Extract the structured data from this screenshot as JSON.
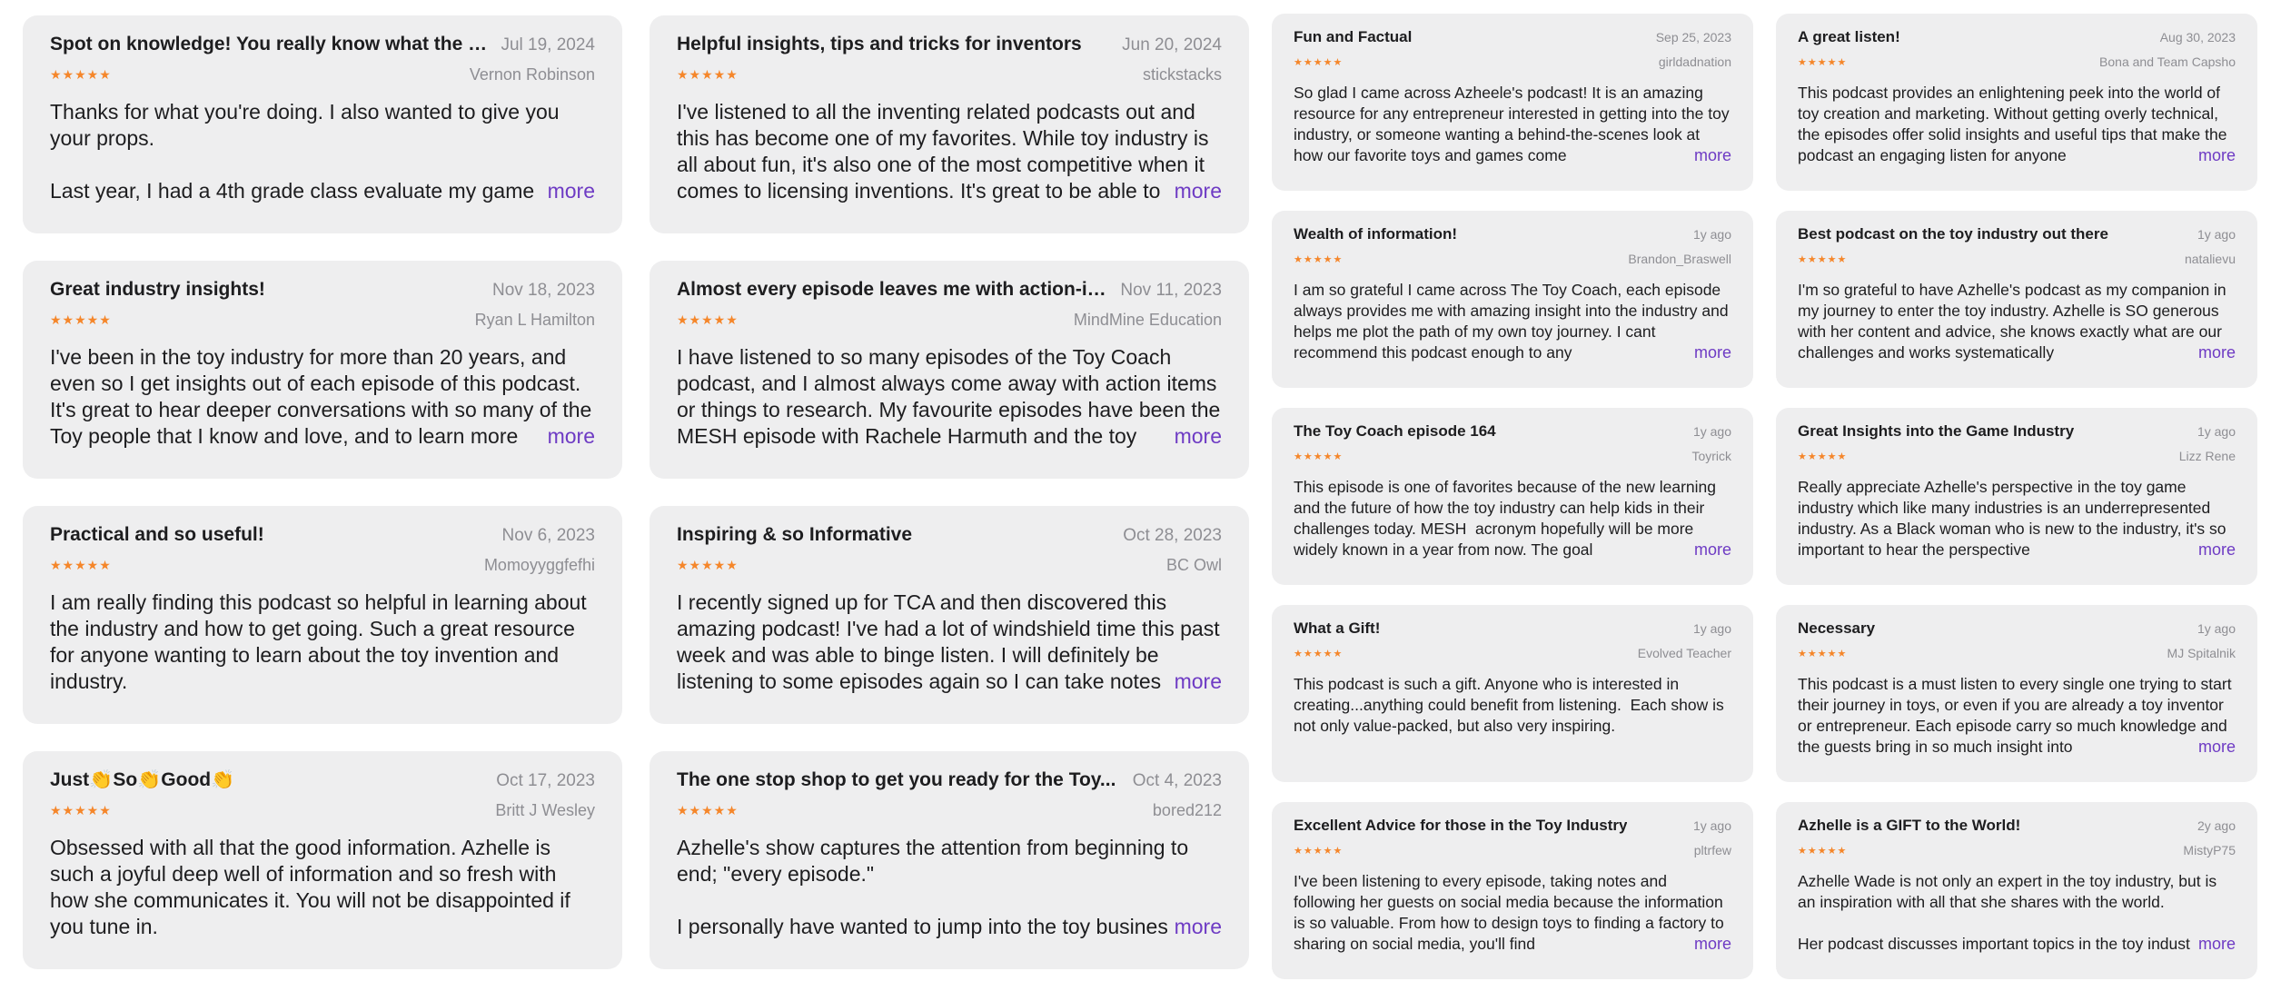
{
  "left_reviews": [
    {
      "title": "Spot on knowledge! You really know what the k...",
      "date": "Jul 19, 2024",
      "author": "Vernon Robinson",
      "stars": "★★★★★",
      "body": "Thanks for what you're doing. I also wanted to give you your props.\n\nLast year, I had a 4th grade class evaluate my game",
      "more": "more"
    },
    {
      "title": "Helpful insights, tips and tricks for inventors",
      "date": "Jun 20, 2024",
      "author": "stickstacks",
      "stars": "★★★★★",
      "body": "I've listened to all the inventing related podcasts out and this has become one of my favorites. While toy industry is all about fun, it's also one of the most competitive when it comes to licensing inventions. It's great to be able to",
      "more": "more"
    },
    {
      "title": "Great industry insights!",
      "date": "Nov 18, 2023",
      "author": "Ryan L Hamilton",
      "stars": "★★★★★",
      "body": "I've been in the toy industry for more than 20 years, and even so I get insights out of each episode of this podcast. It's great to hear deeper conversations with so many of the Toy people that I know and love, and to learn more",
      "more": "more"
    },
    {
      "title": "Almost every episode leaves me with action-it...",
      "date": "Nov 11, 2023",
      "author": "MindMine Education",
      "stars": "★★★★★",
      "body": "I have listened to so many episodes of the Toy Coach podcast, and I almost always come away with action items or things to research. My favourite episodes have been the MESH episode with Rachele Harmuth and the toy",
      "more": "more"
    },
    {
      "title": "Practical and so useful!",
      "date": "Nov 6, 2023",
      "author": "Momoyyggfefhi",
      "stars": "★★★★★",
      "body": "I am really finding this podcast so helpful in learning about the industry and how to get going. Such a great resource for anyone wanting to learn about the toy invention and industry.",
      "more": ""
    },
    {
      "title": "Inspiring & so Informative",
      "date": "Oct 28, 2023",
      "author": "BC Owl",
      "stars": "★★★★★",
      "body": "I recently signed up for TCA and then discovered this amazing podcast! I've had a lot of windshield time this past week and was able to binge listen. I will definitely be listening to some episodes again so I can take notes",
      "more": "more"
    },
    {
      "title": "Just👏So👏Good👏",
      "date": "Oct 17, 2023",
      "author": "Britt J Wesley",
      "stars": "★★★★★",
      "body": "Obsessed with all that the good information. Azhelle is such a joyful deep well of information and so fresh with how she communicates it. You will not be disappointed if you tune in.",
      "more": ""
    },
    {
      "title": "The one stop shop to get you ready for the Toy...",
      "date": "Oct 4, 2023",
      "author": "bored212",
      "stars": "★★★★★",
      "body": "Azhelle's show captures the attention from beginning to end; \"every episode.\"\n\nI personally have wanted to jump into the toy business",
      "more": "more"
    }
  ],
  "right_reviews": [
    {
      "title": "Fun and Factual",
      "date": "Sep 25, 2023",
      "author": "girldadnation",
      "stars": "★★★★★",
      "body": "So glad I came across Azheele's podcast! It is an amazing resource for any entrepreneur interested in getting into the toy industry, or someone wanting a behind-the-scenes look at how our favorite toys and games come",
      "more": "more"
    },
    {
      "title": "A great listen!",
      "date": "Aug 30, 2023",
      "author": "Bona and Team Capsho",
      "stars": "★★★★★",
      "body": "This podcast provides an enlightening peek into the world of toy creation and marketing. Without getting overly technical, the episodes offer solid insights and useful tips that make the podcast an engaging listen for anyone",
      "more": "more"
    },
    {
      "title": "Wealth of information!",
      "date": "1y ago",
      "author": "Brandon_Braswell",
      "stars": "★★★★★",
      "body": "I am so grateful I came across The Toy Coach, each episode always provides me with amazing insight into the industry and helps me plot the path of my own toy journey. I cant recommend this podcast enough to any",
      "more": "more"
    },
    {
      "title": "Best podcast on the toy industry out there",
      "date": "1y ago",
      "author": "natalievu",
      "stars": "★★★★★",
      "body": "I'm so grateful to have Azhelle's podcast as my companion in my journey to enter the toy industry. Azhelle is SO generous with her content and advice, she knows exactly what are our challenges and works systematically",
      "more": "more"
    },
    {
      "title": "The Toy Coach episode 164",
      "date": "1y ago",
      "author": "Toyrick",
      "stars": "★★★★★",
      "body": "This episode is one of favorites because of the new learning and the future of how the toy industry can help kids in their challenges today. MESH  acronym hopefully will be more widely known in a year from now. The goal",
      "more": "more"
    },
    {
      "title": "Great Insights into the Game Industry",
      "date": "1y ago",
      "author": "Lizz Rene",
      "stars": "★★★★★",
      "body": "Really appreciate Azhelle's perspective in the toy game industry which like many industries is an underrepresented industry. As a Black woman who is new to the industry, it's so important to hear the perspective",
      "more": "more"
    },
    {
      "title": "What a Gift!",
      "date": "1y ago",
      "author": "Evolved Teacher",
      "stars": "★★★★★",
      "body": "This podcast is such a gift. Anyone who is interested in creating...anything could benefit from listening.  Each show is not only value-packed, but also very inspiring.",
      "more": ""
    },
    {
      "title": "Necessary",
      "date": "1y ago",
      "author": "MJ Spitalnik",
      "stars": "★★★★★",
      "body": "This podcast is a must listen to every single one trying to start their journey in toys, or even if you are already a toy inventor or entrepreneur. Each episode carry so much knowledge and the guests bring in so much insight into",
      "more": "more"
    },
    {
      "title": "Excellent Advice for those in the Toy Industry",
      "date": "1y ago",
      "author": "pltrfew",
      "stars": "★★★★★",
      "body": "I've been listening to every episode, taking notes and following her guests on social media because the information is so valuable. From how to design toys to finding a factory to sharing on social media, you'll find",
      "more": "more"
    },
    {
      "title": "Azhelle is a GIFT to the World!",
      "date": "2y ago",
      "author": "MistyP75",
      "stars": "★★★★★",
      "body": "Azhelle Wade is not only an expert in the toy industry, but is an inspiration with all that she shares with the world.\n\nHer podcast discusses important topics in the toy industry",
      "more": "more"
    }
  ]
}
